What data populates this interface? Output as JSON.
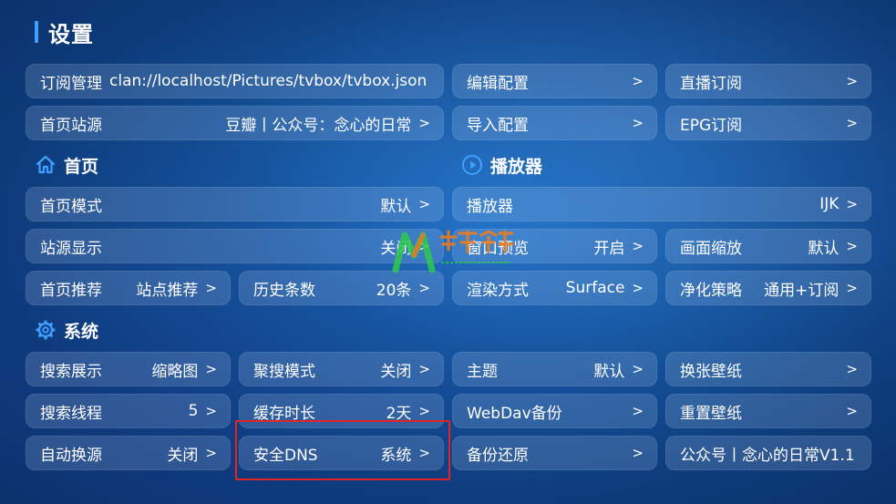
{
  "header": {
    "title": "设置"
  },
  "chevron": ">",
  "rows": {
    "subscription": {
      "label": "订阅管理",
      "value": "clan://localhost/Pictures/tvbox/tvbox.json"
    },
    "edit_config": {
      "label": "编辑配置"
    },
    "live_sub": {
      "label": "直播订阅"
    },
    "home_source": {
      "label": "首页站源",
      "value": "豆瓣丨公众号：念心的日常"
    },
    "import_config": {
      "label": "导入配置"
    },
    "epg_sub": {
      "label": "EPG订阅"
    },
    "home_mode": {
      "label": "首页模式",
      "value": "默认"
    },
    "player": {
      "label": "播放器",
      "value": "IJK"
    },
    "source_display": {
      "label": "站源显示",
      "value": "关闭"
    },
    "window_preview": {
      "label": "窗口预览",
      "value": "开启"
    },
    "image_scale": {
      "label": "画面缩放",
      "value": "默认"
    },
    "home_recommend": {
      "label": "首页推荐",
      "value": "站点推荐"
    },
    "history_count": {
      "label": "历史条数",
      "value": "20条"
    },
    "render_mode": {
      "label": "渲染方式",
      "value": "Surface"
    },
    "purify_policy": {
      "label": "净化策略",
      "value": "通用+订阅"
    },
    "search_display": {
      "label": "搜索展示",
      "value": "缩略图"
    },
    "aggregate_mode": {
      "label": "聚搜模式",
      "value": "关闭"
    },
    "theme": {
      "label": "主题",
      "value": "默认"
    },
    "change_wallpaper": {
      "label": "换张壁纸"
    },
    "search_threads": {
      "label": "搜索线程",
      "value": "5"
    },
    "cache_duration": {
      "label": "缓存时长",
      "value": "2天"
    },
    "webdav_backup": {
      "label": "WebDav备份"
    },
    "reset_wallpaper": {
      "label": "重置壁纸"
    },
    "auto_switch": {
      "label": "自动换源",
      "value": "关闭"
    },
    "secure_dns": {
      "label": "安全DNS",
      "value": "系统"
    },
    "backup_restore": {
      "label": "备份还原"
    },
    "official_account": {
      "label": "公众号丨念心的日常V1.1"
    }
  },
  "sections": {
    "home": {
      "label": "首页",
      "icon": "home-icon"
    },
    "player": {
      "label": "播放器",
      "icon": "play-circle-icon"
    },
    "system": {
      "label": "系统",
      "icon": "gear-icon"
    }
  },
  "colors": {
    "accent": "#3fa0ff",
    "highlight": "#e02424",
    "watermark_green": "#2ec94c",
    "watermark_orange": "#f07d1a"
  }
}
